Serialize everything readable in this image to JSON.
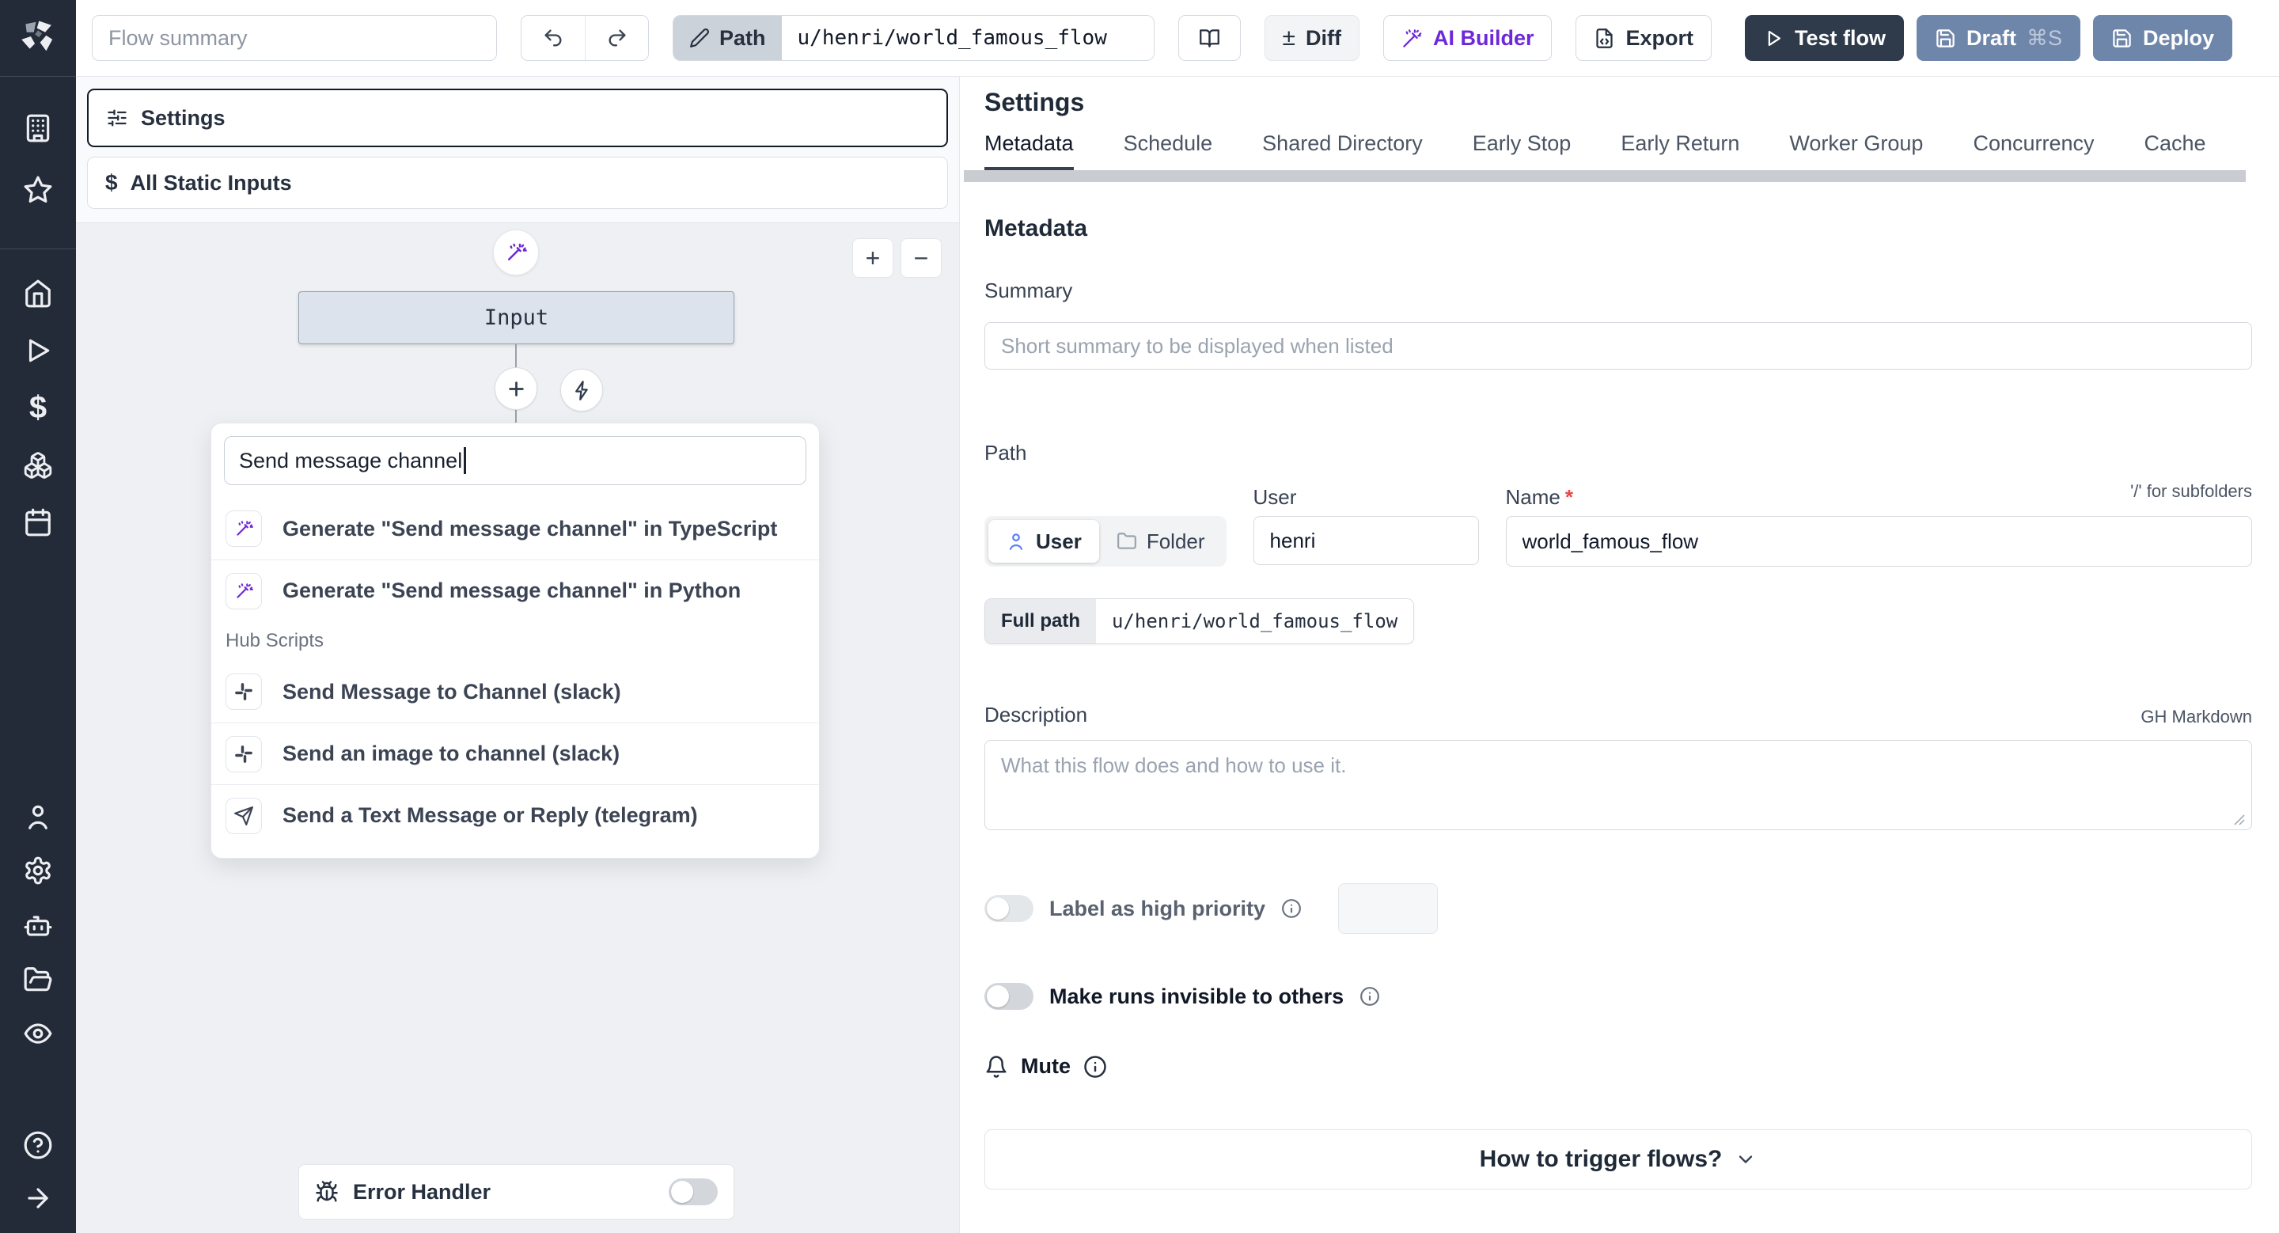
{
  "topbar": {
    "flow_summary_placeholder": "Flow summary",
    "path_label": "Path",
    "path_value": "u/henri/world_famous_flow",
    "diff_icon": "±",
    "diff_label": "Diff",
    "ai_builder_label": "AI Builder",
    "export_label": "Export",
    "test_flow_label": "Test flow",
    "draft_label": "Draft",
    "draft_shortcut": "⌘S",
    "deploy_label": "Deploy"
  },
  "flow_panel": {
    "settings_label": "Settings",
    "static_inputs_icon": "$",
    "static_inputs_label": "All Static Inputs",
    "zoom_in": "+",
    "zoom_out": "−",
    "input_node_label": "Input",
    "search_value": "Send message channel",
    "results": [
      {
        "label": "Generate \"Send message channel\" in TypeScript"
      },
      {
        "label": "Generate \"Send message channel\" in Python"
      }
    ],
    "hub_scripts_header": "Hub Scripts",
    "hub_results": [
      {
        "label": "Send Message to Channel (slack)"
      },
      {
        "label": "Send an image to channel (slack)"
      },
      {
        "label": "Send a Text Message or Reply (telegram)"
      }
    ],
    "error_handler_label": "Error Handler"
  },
  "sidebar": {
    "dollar_icon": "$"
  },
  "settings_panel": {
    "title": "Settings",
    "tabs": [
      "Metadata",
      "Schedule",
      "Shared Directory",
      "Early Stop",
      "Early Return",
      "Worker Group",
      "Concurrency",
      "Cache"
    ],
    "active_tab": "Metadata",
    "metadata": {
      "heading": "Metadata",
      "summary_label": "Summary",
      "summary_placeholder": "Short summary to be displayed when listed",
      "path_label": "Path",
      "user_col_label": "User",
      "name_col_label": "Name",
      "required_asterisk": "*",
      "subfolder_hint": "'/' for subfolders",
      "owner_user_label": "User",
      "owner_folder_label": "Folder",
      "user_value": "henri",
      "name_value": "world_famous_flow",
      "full_path_label": "Full path",
      "full_path_value": "u/henri/world_famous_flow",
      "description_label": "Description",
      "markdown_hint": "GH Markdown",
      "description_placeholder": "What this flow does and how to use it.",
      "high_priority_label": "Label as high priority",
      "invisible_runs_label": "Make runs invisible to others",
      "mute_label": "Mute",
      "trigger_button_label": "How to trigger flows?"
    }
  },
  "colors": {
    "accent_purple": "#6d28d9",
    "dark_button": "#2f3a4b",
    "deploy_blue": "#6e86aa",
    "sidebar_bg": "#232a38",
    "canvas_bg": "#eef0f3",
    "node_fill": "#dce3ec",
    "required_red": "#ef4444"
  }
}
